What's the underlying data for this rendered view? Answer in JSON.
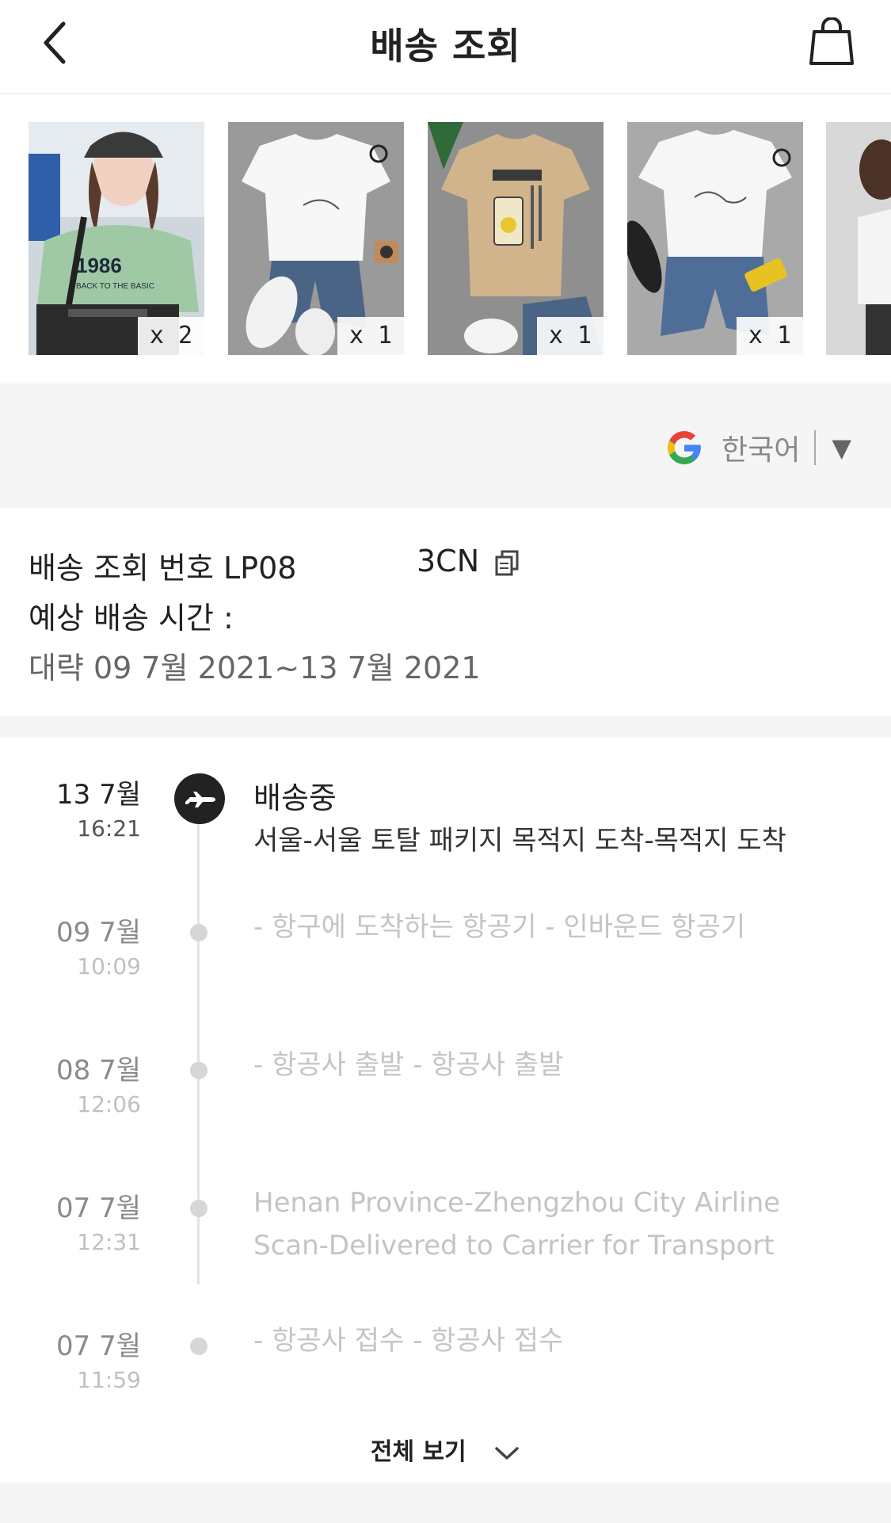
{
  "header": {
    "title": "배송 조회",
    "back_icon": "chevron-left-icon",
    "bag_icon": "shopping-bag-icon"
  },
  "products": [
    {
      "name": "green-tshirt-model",
      "qty": "x 2"
    },
    {
      "name": "white-tshirt-denim-shorts",
      "qty": "x 1"
    },
    {
      "name": "beige-tshirt-graphic",
      "qty": "x 1"
    },
    {
      "name": "white-tshirt-signature",
      "qty": "x 1"
    },
    {
      "name": "partial-product",
      "qty": ""
    }
  ],
  "translate": {
    "icon": "google-g-icon",
    "language": "한국어",
    "caret": "▼"
  },
  "tracking": {
    "number_label": "배송 조회 번호 LP08",
    "number_suffix": "3CN",
    "estimate_label": "예상 배송 시간 :",
    "estimate_value": "대략 09 7월 2021~13 7월 2021",
    "copy_icon": "copy-icon"
  },
  "events": [
    {
      "date": "13 7월",
      "time": "16:21",
      "status": "배송중",
      "detail": "서울-서울 토탈 패키지 목적지 도착-목적지 도착",
      "icon": "airplane-icon"
    },
    {
      "date": "09 7월",
      "time": "10:09",
      "detail": "- 항구에 도착하는 항공기 - 인바운드 항공기"
    },
    {
      "date": "08 7월",
      "time": "12:06",
      "detail": "- 항공사 출발 - 항공사 출발"
    },
    {
      "date": "07 7월",
      "time": "12:31",
      "detail": "Henan Province-Zhengzhou City Airline Scan-Delivered to Carrier for Transport"
    },
    {
      "date": "07 7월",
      "time": "11:59",
      "detail": "- 항공사 접수 - 항공사 접수"
    }
  ],
  "view_all": {
    "label": "전체 보기",
    "icon": "chevron-down-icon"
  }
}
